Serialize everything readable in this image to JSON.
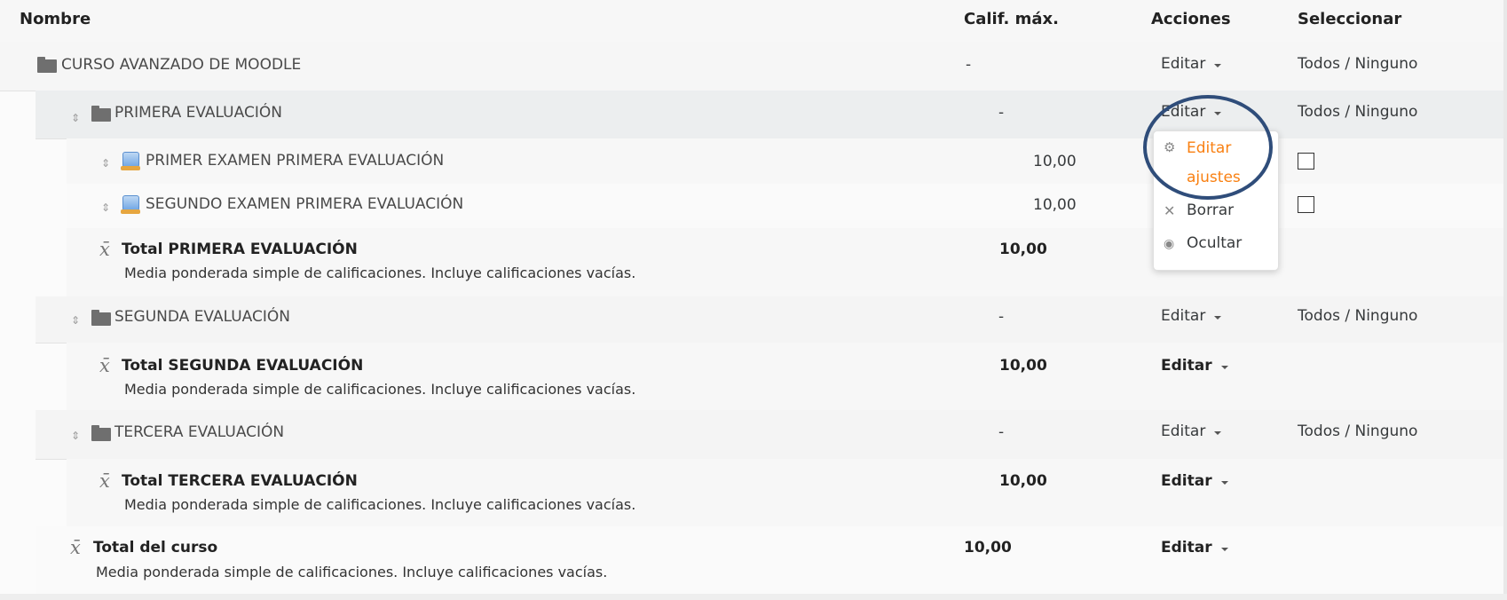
{
  "header": {
    "name": "Nombre",
    "max_grade": "Calif. máx.",
    "actions": "Acciones",
    "select": "Seleccionar"
  },
  "rows": {
    "course": {
      "name": "CURSO AVANZADO DE MOODLE",
      "max": "-",
      "action": "Editar",
      "select": "Todos / Ninguno"
    },
    "cat1": {
      "name": "PRIMERA EVALUACIÓN",
      "max": "-",
      "action": "Editar",
      "select": "Todos / Ninguno"
    },
    "item1": {
      "name": "PRIMER EXAMEN PRIMERA EVALUACIÓN",
      "max": "10,00"
    },
    "item2": {
      "name": "SEGUNDO EXAMEN PRIMERA EVALUACIÓN",
      "max": "10,00"
    },
    "total1": {
      "name": "Total PRIMERA EVALUACIÓN",
      "desc": "Media ponderada simple de calificaciones. Incluye calificaciones vacías.",
      "max": "10,00"
    },
    "cat2": {
      "name": "SEGUNDA EVALUACIÓN",
      "max": "-",
      "action": "Editar",
      "select": "Todos / Ninguno"
    },
    "total2": {
      "name": "Total SEGUNDA EVALUACIÓN",
      "desc": "Media ponderada simple de calificaciones. Incluye calificaciones vacías.",
      "max": "10,00",
      "action": "Editar"
    },
    "cat3": {
      "name": "TERCERA EVALUACIÓN",
      "max": "-",
      "action": "Editar",
      "select": "Todos / Ninguno"
    },
    "total3": {
      "name": "Total TERCERA EVALUACIÓN",
      "desc": "Media ponderada simple de calificaciones. Incluye calificaciones vacías.",
      "max": "10,00",
      "action": "Editar"
    },
    "course_total": {
      "name": "Total del curso",
      "desc": "Media ponderada simple de calificaciones. Incluye calificaciones vacías.",
      "max": "10,00",
      "action": "Editar"
    }
  },
  "menu": {
    "edit_line1": "Editar",
    "edit_line2": "ajustes",
    "delete": "Borrar",
    "hide": "Ocultar"
  },
  "colors": {
    "highlight_orange": "#f98012",
    "circle": "#2f4d7a"
  },
  "icons": [
    "folder-icon",
    "move-icon",
    "assignment-icon",
    "mean-icon",
    "gear-icon",
    "delete-icon",
    "eye-icon",
    "chevron-down-icon"
  ]
}
